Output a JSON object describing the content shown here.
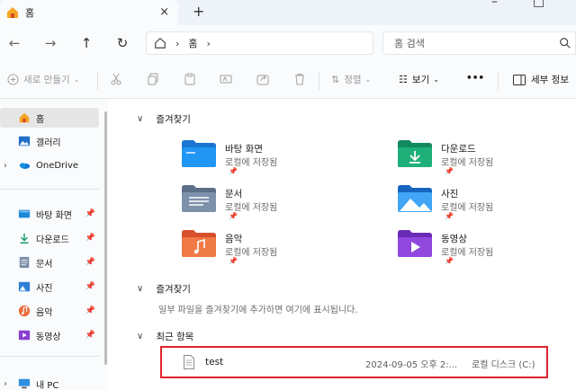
{
  "tab": {
    "title": "홈",
    "close": "×",
    "new": "+"
  },
  "window": {
    "minimize": "–",
    "maximize": "□"
  },
  "nav": {
    "back": "←",
    "forward": "→",
    "up": "↑",
    "refresh": "↻"
  },
  "address": {
    "crumb": "홈",
    "separator": "›",
    "separator2": "›"
  },
  "search": {
    "placeholder": "홈 검색"
  },
  "commands": {
    "new": "새로 만들기",
    "sort": "정렬",
    "view": "보기",
    "more": "•••",
    "details": "세부 정보"
  },
  "sidebar": {
    "items": [
      {
        "label": "홈",
        "icon": "home-icon"
      },
      {
        "label": "갤러리",
        "icon": "gallery-icon"
      },
      {
        "label": "OneDrive",
        "icon": "onedrive-icon"
      },
      {
        "label": "바탕 화면",
        "icon": "desktop-icon"
      },
      {
        "label": "다운로드",
        "icon": "download-icon"
      },
      {
        "label": "문서",
        "icon": "documents-icon"
      },
      {
        "label": "사진",
        "icon": "pictures-icon"
      },
      {
        "label": "음악",
        "icon": "music-icon"
      },
      {
        "label": "동영상",
        "icon": "videos-icon"
      },
      {
        "label": "내 PC",
        "icon": "pc-icon"
      }
    ]
  },
  "main": {
    "quick_access_title": "즐겨찾기",
    "quick_access": [
      {
        "name": "바탕 화면",
        "sub": "로컬에 저장됨"
      },
      {
        "name": "다운로드",
        "sub": "로컬에 저장됨"
      },
      {
        "name": "문서",
        "sub": "로컬에 저장됨"
      },
      {
        "name": "사진",
        "sub": "로컬에 저장됨"
      },
      {
        "name": "음악",
        "sub": "로컬에 저장됨"
      },
      {
        "name": "동영상",
        "sub": "로컬에 저장됨"
      }
    ],
    "favorites_title": "즐겨찾기",
    "favorites_hint": "일부 파일을 즐겨찾기에 추가하면 여기에 표시됩니다.",
    "recent_title": "최근 항목",
    "recent": [
      {
        "name": "test",
        "date": "2024-09-05 오후 2:...",
        "location": "로컬 디스크 (C:)"
      }
    ]
  },
  "colors": {
    "accent": "#0067c0",
    "highlight": "#e0232b",
    "folder": "#f8c64b"
  }
}
